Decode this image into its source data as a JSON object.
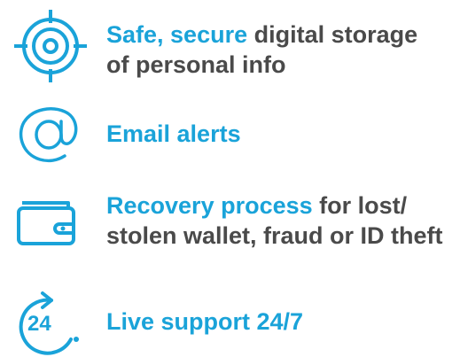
{
  "colors": {
    "accent": "#1aa3d9",
    "text": "#4a4a4a"
  },
  "features": [
    {
      "icon": "target-icon",
      "highlight": "Safe, secure",
      "rest": " digital storage of personal info"
    },
    {
      "icon": "at-sign-icon",
      "highlight": "Email alerts",
      "rest": ""
    },
    {
      "icon": "wallet-icon",
      "highlight": "Recovery process",
      "rest": " for lost/ stolen wallet, fraud or ID theft"
    },
    {
      "icon": "24-7-clock-icon",
      "icon_text": "24",
      "highlight": "Live support 24/7",
      "rest": ""
    }
  ]
}
